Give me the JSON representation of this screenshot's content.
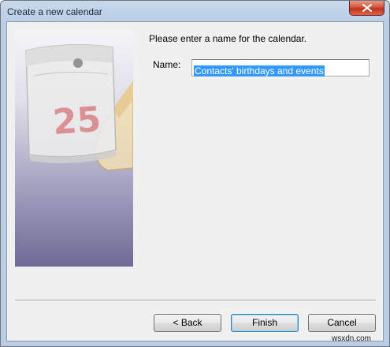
{
  "window": {
    "title": "Create a new calendar"
  },
  "wizard": {
    "prompt": "Please enter a name for the calendar.",
    "name_label": "Name:",
    "name_value": "Contacts' birthdays and events",
    "illustration_day": "25"
  },
  "buttons": {
    "back": "< Back",
    "finish": "Finish",
    "cancel": "Cancel"
  },
  "watermark": "wsxdn.com"
}
